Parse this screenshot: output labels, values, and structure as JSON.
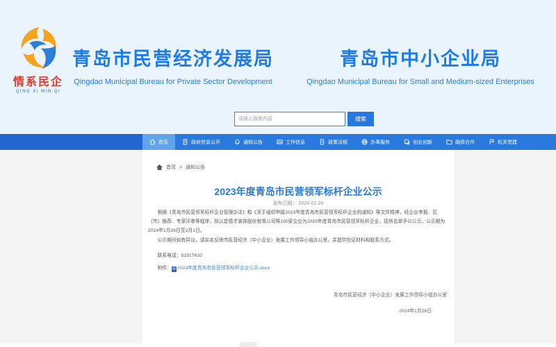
{
  "header": {
    "logo": {
      "line1": "情系民企",
      "line2": "QING XI MIN QI"
    },
    "bureau1": {
      "title": "青岛市民营经济发展局",
      "subtitle": "Qingdao Municipal Bureau for Private Sector Development"
    },
    "bureau2": {
      "title": "青岛市中小企业局",
      "subtitle": "Qingdao Municipal Bureau for Small and Medium-sized Enterprises"
    },
    "search": {
      "placeholder": "请输入搜索内容",
      "button_label": "搜索"
    }
  },
  "nav": {
    "items": [
      {
        "label": "首页",
        "icon": "home-icon",
        "active": true
      },
      {
        "label": "政府信息公开",
        "icon": "document-icon",
        "active": false
      },
      {
        "label": "通知公告",
        "icon": "bell-icon",
        "active": false
      },
      {
        "label": "工作信息",
        "icon": "picture-icon",
        "active": false
      },
      {
        "label": "政策法规",
        "icon": "scroll-icon",
        "active": false
      },
      {
        "label": "办事服务",
        "icon": "globe-icon",
        "active": false
      },
      {
        "label": "创业创新",
        "icon": "copy-icon",
        "active": false
      },
      {
        "label": "融资合作",
        "icon": "folder-icon",
        "active": false
      },
      {
        "label": "机关党建",
        "icon": "flag-icon",
        "active": false
      }
    ]
  },
  "breadcrumb": {
    "home": "首页",
    "separator": ">",
    "current": "通知公告"
  },
  "article": {
    "title": "2023年度青岛市民营领军标杆企业公示",
    "date_label": "发布日期：",
    "date_value": "2024-01-26",
    "paragraph1": "根据《青岛市民营领军标杆企业管理办法》和《关于组织申报2023年度青岛市民营领军标杆企业的通知》等文件精神，经企业申报、区（市）推荐、专家评审等程序，拟认定德才装饰股份有限公司等190家企业为2023年度青岛市民营领军标杆企业，现将名单予以公示，公示期为2024年1月26日至2月1日。",
    "paragraph2": "公示期间如有异议，请实名反映市民营经济（中小企业）发展工作领导小组办公室，并提供佐证材料和联系方式。",
    "phone_line": "联系电话：51917610",
    "attachment_label": "附件：",
    "attachment_link": "2023年度青岛市民营领军标杆企业公示.docx",
    "doc_badge": "W",
    "signature": "青岛市民营经济（中小企业）发展工作领导小组办公室",
    "sign_date": "2024年1月26日"
  },
  "colors": {
    "header_bg": "#e9f4fd",
    "title_blue": "#1e7ce8",
    "nav_bg": "#2a79df",
    "nav_active": "#60a5ec",
    "link": "#4285d7",
    "side_bg": "#f4f4f4"
  }
}
